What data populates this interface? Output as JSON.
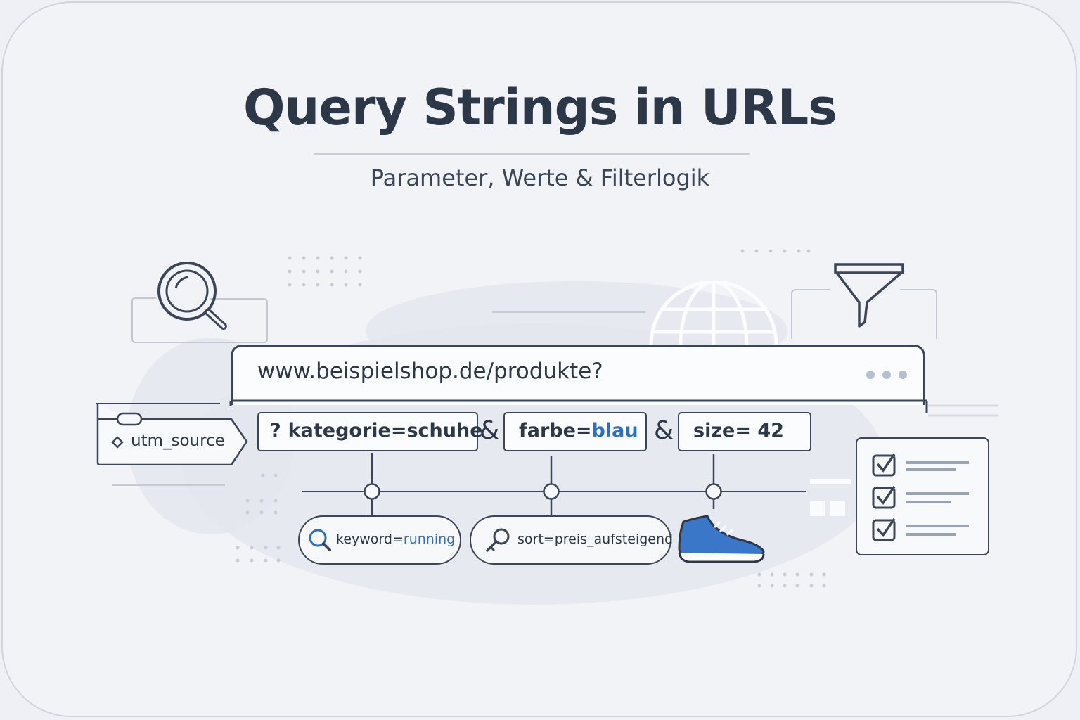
{
  "title": "Query Strings in URLs",
  "subtitle": "Parameter, Werte & Filterlogik",
  "browser": {
    "url": "www.beispielshop.de/produkte?"
  },
  "params": {
    "p1_prefix": "?",
    "p1_text": "kategorie=schuhe",
    "amp1": "&",
    "p2_key": "farbe=",
    "p2_value": "blau",
    "amp2": "&",
    "p3_text": "size= 42"
  },
  "utm": {
    "label": "utm_source"
  },
  "pills": {
    "keyword_key": "keyword=",
    "keyword_value": "running",
    "sort": "sort=preis_aufsteigend"
  },
  "colors": {
    "accent": "#2d6fc0",
    "ink": "#3b4658",
    "background": "#eef0f5"
  },
  "icons": [
    "search-icon",
    "globe-icon",
    "funnel-icon",
    "tag-icon",
    "magnifier-icon",
    "key-icon",
    "shoe-icon",
    "checkbox-icon"
  ]
}
